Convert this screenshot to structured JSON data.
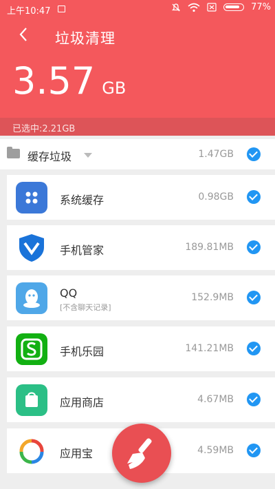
{
  "status": {
    "time": "上午10:47",
    "battery": "77%"
  },
  "header": {
    "title": "垃圾清理",
    "size_value": "3.57",
    "size_unit": "GB",
    "selected": "已选中:2.21GB"
  },
  "section": {
    "label": "缓存垃圾",
    "size": "1.47GB"
  },
  "items": [
    {
      "name": "系统缓存",
      "size": "0.98GB",
      "icon": "system-cache-icon"
    },
    {
      "name": "手机管家",
      "size": "189.81MB",
      "icon": "phone-manager-icon"
    },
    {
      "name": "QQ",
      "note": "[不含聊天记录]",
      "size": "152.9MB",
      "icon": "qq-icon"
    },
    {
      "name": "手机乐园",
      "size": "141.21MB",
      "icon": "phone-paradise-icon"
    },
    {
      "name": "应用商店",
      "size": "4.67MB",
      "icon": "app-store-icon"
    },
    {
      "name": "应用宝",
      "size": "4.59MB",
      "icon": "yingyongbao-icon"
    }
  ],
  "colors": {
    "header": "#f4585c",
    "check": "#2196f3",
    "fab": "#e94f53"
  }
}
